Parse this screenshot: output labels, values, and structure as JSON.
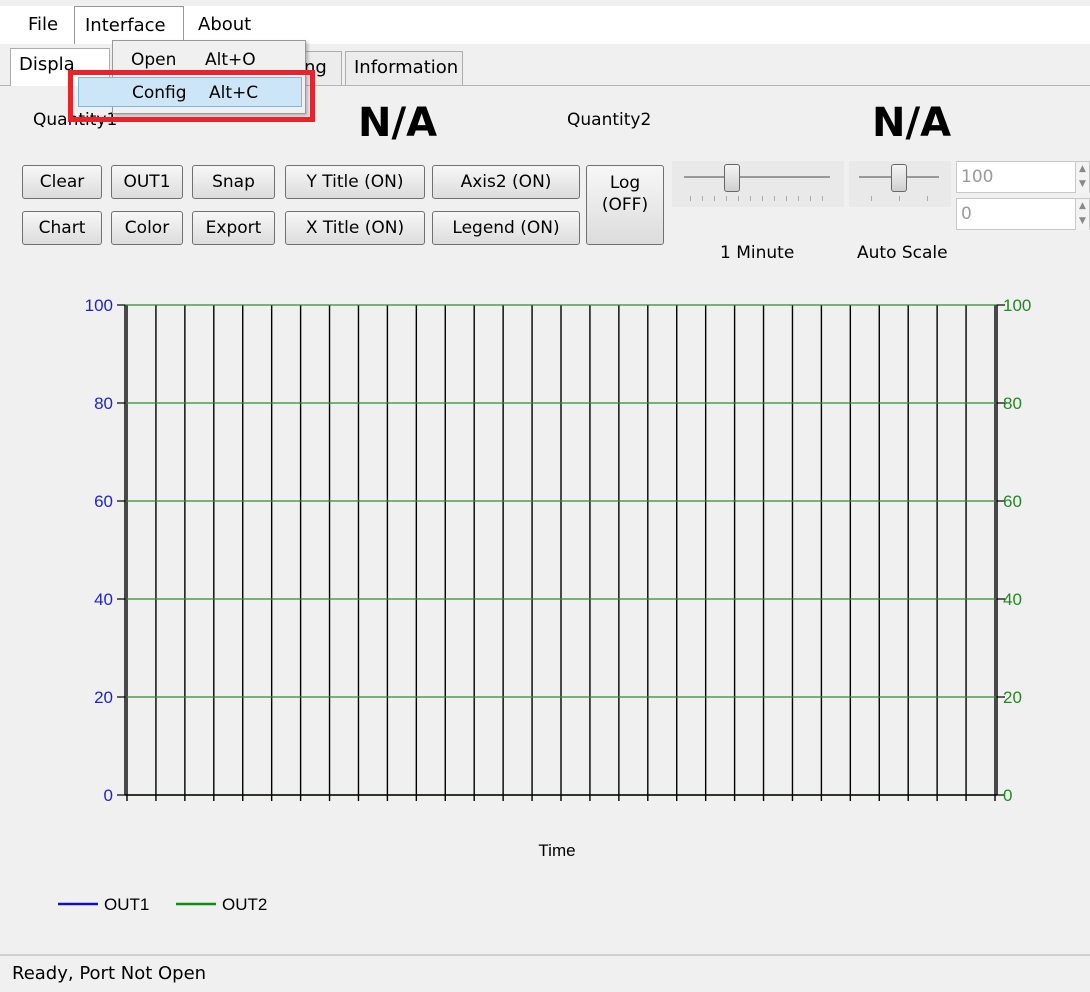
{
  "menubar": {
    "items": [
      "File",
      "Interface",
      "About"
    ]
  },
  "dropdown": {
    "items": [
      {
        "label": "Open",
        "shortcut": "Alt+O"
      },
      {
        "label": "Config",
        "shortcut": "Alt+C"
      }
    ]
  },
  "tabs": {
    "tab1_visible": "Displa",
    "tab2_visible": "ing",
    "tab3": "Information"
  },
  "header": {
    "quantity1_label": "Quantity1",
    "quantity1_value": "N/A",
    "quantity2_label": "Quantity2",
    "quantity2_value": "N/A"
  },
  "buttons": {
    "clear": "Clear",
    "out1": "OUT1",
    "snap": "Snap",
    "ytitle": "Y Title (ON)",
    "axis2": "Axis2 (ON)",
    "chart": "Chart",
    "color": "Color",
    "export": "Export",
    "xtitle": "X Title (ON)",
    "legend": "Legend (ON)",
    "log": "Log\n(OFF)"
  },
  "time_slider": {
    "label": "1 Minute"
  },
  "scale_slider": {
    "label": "Auto Scale"
  },
  "scale_inputs": {
    "max": "100",
    "min": "0"
  },
  "chart_data": {
    "type": "line",
    "xlabel": "Time",
    "y_left": {
      "ticks": [
        0,
        20,
        40,
        60,
        80,
        100
      ],
      "ylim": [
        0,
        100
      ],
      "color": "#2222cc"
    },
    "y_right": {
      "ticks": [
        0,
        20,
        40,
        60,
        80,
        100
      ],
      "ylim": [
        0,
        100
      ],
      "color": "#228822"
    },
    "grid": true,
    "vertical_gridlines": 31,
    "series": [
      {
        "name": "OUT1",
        "color": "#1111bb",
        "values": []
      },
      {
        "name": "OUT2",
        "color": "#118811",
        "values": []
      }
    ],
    "legend_position": "bottom-left"
  },
  "status": {
    "text": "Ready,   Port Not Open"
  }
}
